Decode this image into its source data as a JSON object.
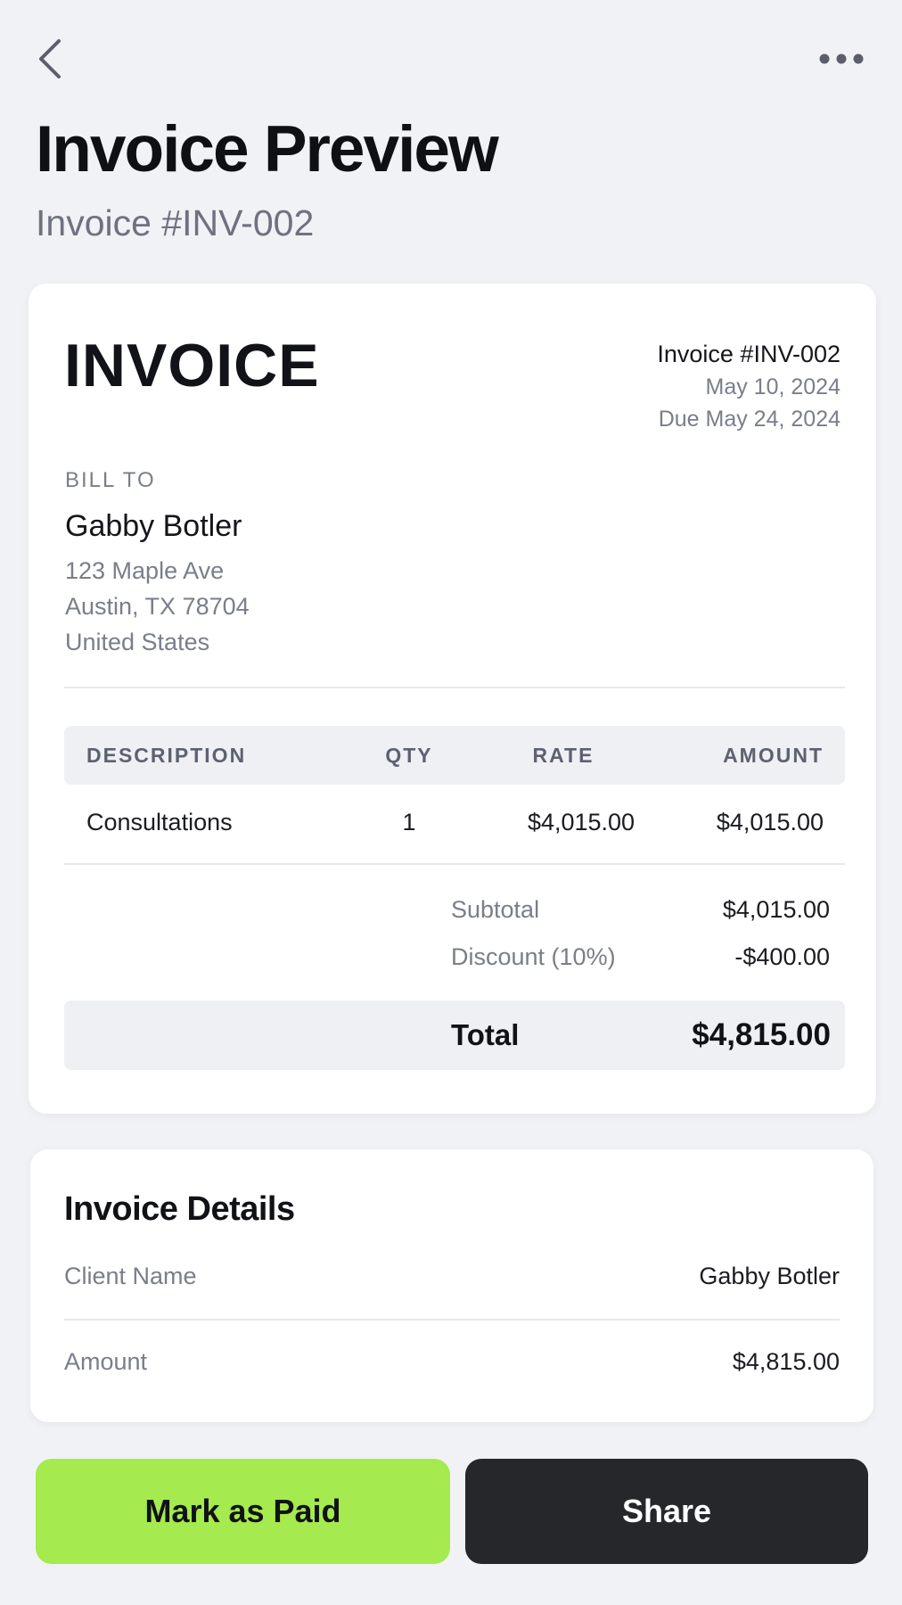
{
  "header": {
    "back_icon": "chevron-left-icon",
    "more_icon": "more-horizontal-icon",
    "title": "Invoice Preview",
    "subtitle": "Invoice #INV-002"
  },
  "invoice": {
    "heading": "INVOICE",
    "number": "Invoice #INV-002",
    "date": "May 10, 2024",
    "due": "Due May 24, 2024",
    "bill_to": {
      "label": "BILL TO",
      "name": "Gabby Botler",
      "address": [
        "123 Maple Ave",
        "Austin, TX 78704",
        "United States"
      ]
    },
    "table": {
      "headers": {
        "description": "DESCRIPTION",
        "qty": "QTY",
        "rate": "RATE",
        "amount": "AMOUNT"
      },
      "rows": [
        {
          "description": "Consultations",
          "qty": "1",
          "rate": "$4,015.00",
          "amount": "$4,015.00"
        }
      ]
    },
    "subtotal_label": "Subtotal",
    "subtotal_value": "$4,015.00",
    "discount_label": "Discount (10%)",
    "discount_value": "-$400.00",
    "total_label": "Total",
    "total_value": "$4,815.00"
  },
  "details": {
    "title": "Invoice Details",
    "client_label": "Client Name",
    "client_value": "Gabby Botler",
    "amount_label": "Amount",
    "amount_value": "$4,815.00"
  },
  "actions": {
    "mark_paid": "Mark as Paid",
    "share": "Share"
  },
  "colors": {
    "background": "#f1f2f5",
    "card": "#ffffff",
    "accent_green": "#a5ea4e",
    "dark_button": "#26272b",
    "muted_text": "#7a7e8a"
  }
}
